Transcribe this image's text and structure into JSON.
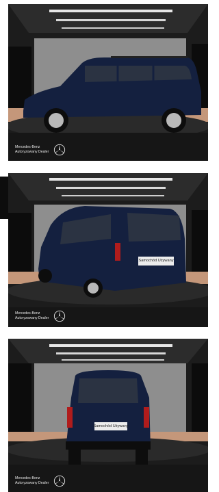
{
  "gallery": {
    "photos": [
      {
        "view": "side",
        "dealer_line1": "Mercedes-Benz",
        "dealer_line2": "Autoryzowany Dealer",
        "logo_icon": "mercedes-star-icon",
        "plate_text": ""
      },
      {
        "view": "rear-three-quarter",
        "dealer_line1": "Mercedes-Benz",
        "dealer_line2": "Autoryzowany Dealer",
        "logo_icon": "mercedes-star-icon",
        "plate_text": "Samochód Używany"
      },
      {
        "view": "rear",
        "dealer_line1": "Mercedes-Benz",
        "dealer_line2": "Autoryzowany Dealer",
        "logo_icon": "mercedes-star-icon",
        "plate_text": "Samochód Używany"
      }
    ]
  },
  "colors": {
    "car_body": "#14203f",
    "floor": "#c4977a",
    "backdrop": "#8e8e8e",
    "studio_dark": "#171717"
  }
}
